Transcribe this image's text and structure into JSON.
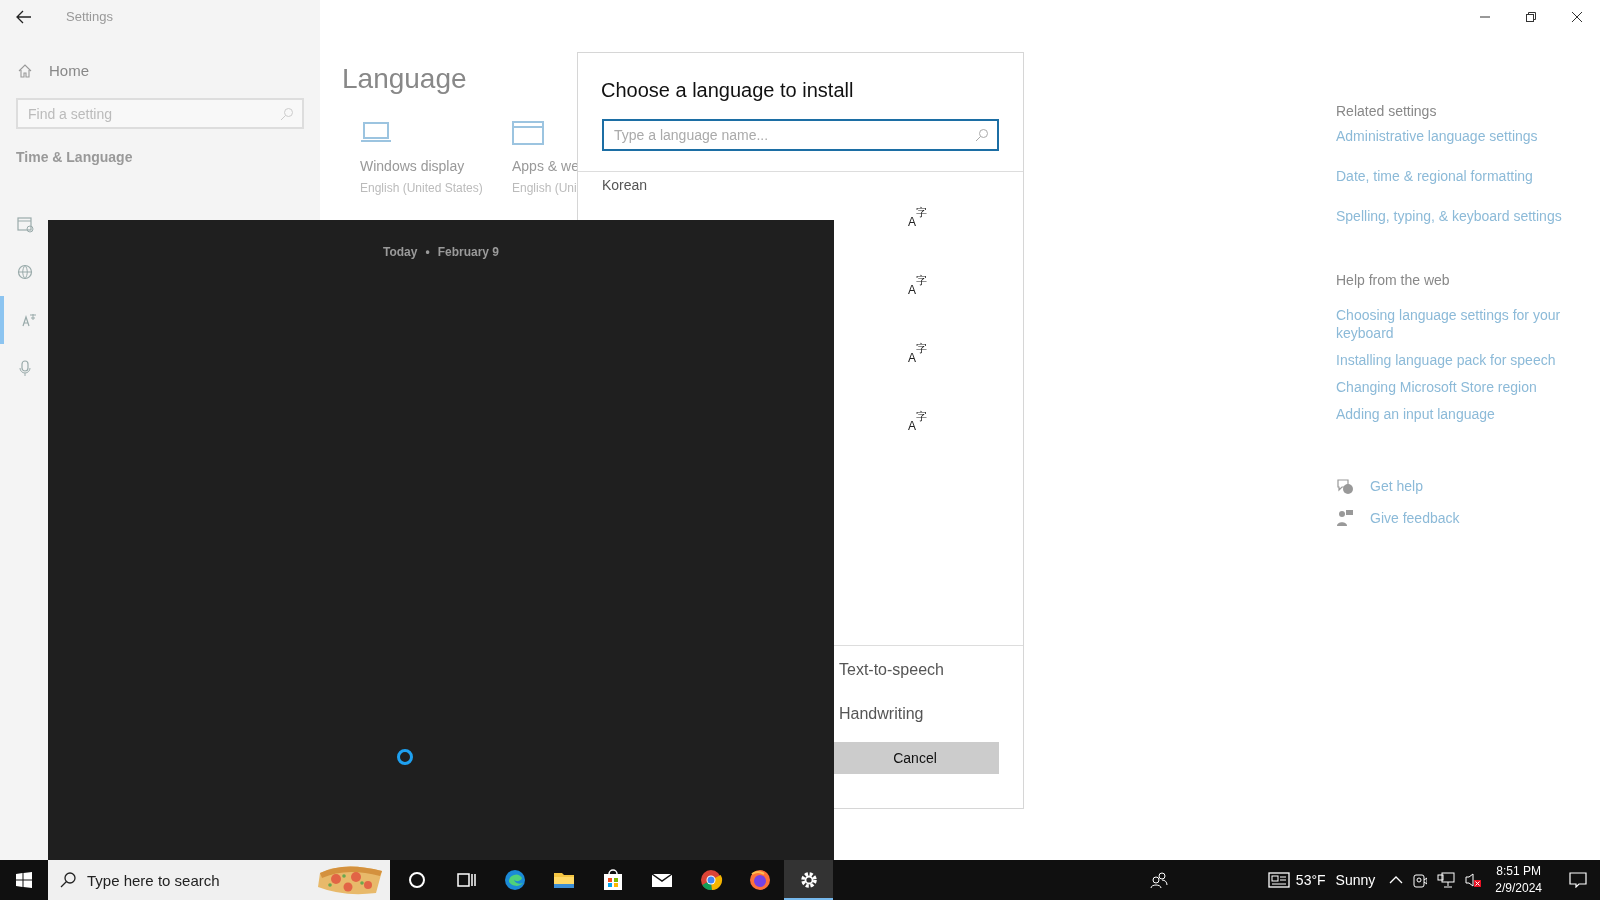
{
  "window": {
    "title": "Settings"
  },
  "sidebar": {
    "home": "Home",
    "search": {
      "placeholder": "Find a setting"
    },
    "section": "Time & Language",
    "items": [
      {
        "kind": "calendar",
        "selected": false
      },
      {
        "kind": "globe",
        "selected": false
      },
      {
        "kind": "language",
        "selected": true
      },
      {
        "kind": "microphone",
        "selected": false
      }
    ]
  },
  "main": {
    "heading": "Language",
    "tiles": [
      {
        "kind": "laptop",
        "label": "Windows display",
        "value": "English (United States)"
      },
      {
        "kind": "window",
        "label": "Apps & we",
        "value": "English (Uni"
      }
    ]
  },
  "dialog": {
    "title": "Choose a language to install",
    "search": {
      "placeholder": "Type a language name..."
    },
    "languages": [
      {
        "name": "Korean"
      }
    ],
    "feature_icons": [
      "A$^{字}$",
      "A$^{字}$",
      "A$^{字}$",
      "A$^{字}$"
    ],
    "features": [
      "Text-to-speech",
      "Handwriting"
    ],
    "cancel": "Cancel"
  },
  "calendar_flyout": {
    "day": "Today",
    "separator": "•",
    "date": "February 9"
  },
  "related": {
    "heading": "Related settings",
    "links": [
      "Administrative language settings",
      "Date, time & regional formatting",
      "Spelling, typing, & keyboard settings"
    ]
  },
  "help": {
    "heading": "Help from the web",
    "links": [
      "Choosing language settings for your keyboard",
      "Installing language pack for speech",
      "Changing Microsoft Store region",
      "Adding an input language"
    ]
  },
  "support": [
    {
      "kind": "help",
      "label": "Get help"
    },
    {
      "kind": "feedback",
      "label": "Give feedback"
    }
  ],
  "taskbar": {
    "search_placeholder": "Type here to search",
    "apps": [
      {
        "kind": "cortana",
        "active": false
      },
      {
        "kind": "taskview",
        "active": false
      },
      {
        "kind": "edge",
        "active": false
      },
      {
        "kind": "explorer",
        "active": false
      },
      {
        "kind": "store",
        "active": false
      },
      {
        "kind": "mail",
        "active": false
      },
      {
        "kind": "chrome",
        "active": false
      },
      {
        "kind": "firefox",
        "active": false
      },
      {
        "kind": "settings",
        "active": true
      }
    ],
    "weather": {
      "temp": "53°F",
      "condition": "Sunny"
    },
    "time": "8:51 PM",
    "date": "2/9/2024"
  }
}
